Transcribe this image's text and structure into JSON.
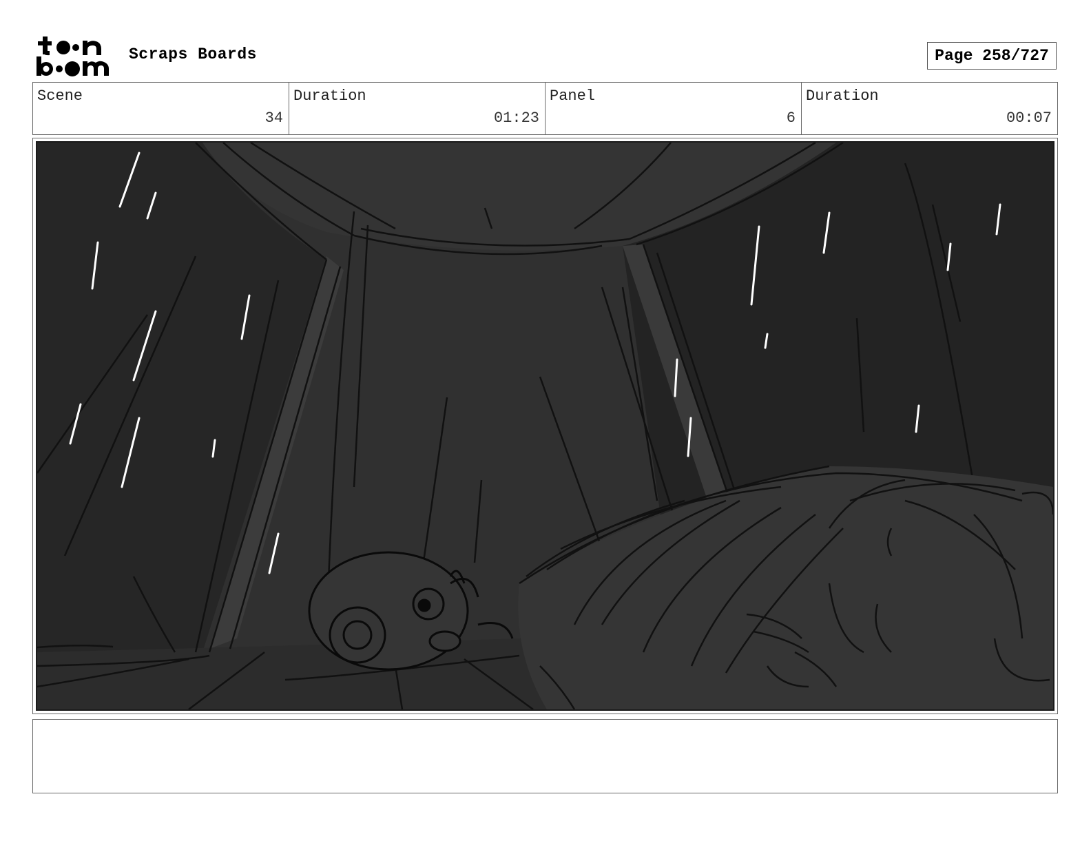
{
  "header": {
    "logo_text_top": "toon",
    "logo_text_bottom": "boom",
    "board_title": "Scraps Boards",
    "page_label": "Page 258/727"
  },
  "info": {
    "scene_label": "Scene",
    "scene_value": "34",
    "scene_duration_label": "Duration",
    "scene_duration_value": "01:23",
    "panel_label": "Panel",
    "panel_value": "6",
    "panel_duration_label": "Duration",
    "panel_duration_value": "00:07"
  },
  "panel": {
    "image_description": "rain-tent-sketch",
    "background_color": "#2f2f2f"
  },
  "notes": {
    "text": ""
  }
}
